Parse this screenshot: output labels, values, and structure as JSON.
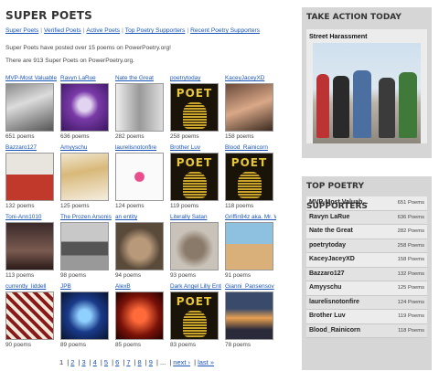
{
  "main": {
    "title": "SUPER POETS",
    "subnav": [
      "Super Poets",
      "Verified Poets",
      "Active Poets",
      "Top Poetry Supporters",
      "Recent Poetry Supporters"
    ],
    "info1": "Super Poets have posted over 15 poems on PowerPoetry.org!",
    "info2": "There are 913 Super Poets on PowerPoetry.org.",
    "poets": [
      {
        "name": "MVP-Most Valuable",
        "count": "651 poems",
        "thumb": "photo-man-cap"
      },
      {
        "name": "Ravyn LaRue",
        "count": "636 poems",
        "thumb": "art-purple"
      },
      {
        "name": "Nate the Great",
        "count": "282 poems",
        "thumb": "photo-bw"
      },
      {
        "name": "poetrytoday",
        "count": "258 poems",
        "thumb": "poet"
      },
      {
        "name": "KaceyJaceyXD",
        "count": "158 poems",
        "thumb": "photo-girls"
      },
      {
        "name": "Bazzaro127",
        "count": "132 poems",
        "thumb": "photo-man-red"
      },
      {
        "name": "Amyyschu",
        "count": "125 poems",
        "thumb": "photo-blonde"
      },
      {
        "name": "laurelisnotonfire",
        "count": "124 poems",
        "thumb": "drawing-hands"
      },
      {
        "name": "Brother Luv",
        "count": "119 poems",
        "thumb": "poet"
      },
      {
        "name": "Blood_Rainicorn",
        "count": "118 poems",
        "thumb": "poet"
      },
      {
        "name": "Toni-Ann1010",
        "count": "113 poems",
        "thumb": "photo-dark"
      },
      {
        "name": "The Prozen Arsonist",
        "count": "98 poems",
        "thumb": "photo-train"
      },
      {
        "name": "an entity",
        "count": "94 poems",
        "thumb": "photo-cat"
      },
      {
        "name": "Literally Satan",
        "count": "93 poems",
        "thumb": "photo-hamster"
      },
      {
        "name": "Griffin94z aka. Mr. Warlow",
        "count": "91 poems",
        "thumb": "photo-beach"
      },
      {
        "name": "currently_liddell",
        "count": "90 poems",
        "thumb": "art-pattern"
      },
      {
        "name": "JPB",
        "count": "89 poems",
        "thumb": "art-blue"
      },
      {
        "name": "AlexB",
        "count": "85 poems",
        "thumb": "photo-red"
      },
      {
        "name": "Dark Angel Lilly Entity",
        "count": "83 poems",
        "thumb": "poet"
      },
      {
        "name": "Gianni_Pansensov",
        "count": "78 poems",
        "thumb": "photo-sunset"
      }
    ],
    "poet_word": "POET",
    "pager": {
      "current": "1",
      "pages": [
        "2",
        "3",
        "4",
        "5",
        "6",
        "7",
        "8",
        "9"
      ],
      "ellipsis": "...",
      "next": "next ›",
      "last": "last »"
    }
  },
  "sidebar": {
    "take_action": {
      "title": "TAKE ACTION TODAY",
      "subtitle": "Street Harassment"
    },
    "supporters": {
      "title": "TOP POETRY SUPPORTERS",
      "items": [
        {
          "name": "MVP-Most Valuab...",
          "count": "651 Poems"
        },
        {
          "name": "Ravyn LaRue",
          "count": "636 Poems"
        },
        {
          "name": "Nate the Great",
          "count": "282 Poems"
        },
        {
          "name": "poetrytoday",
          "count": "258 Poems"
        },
        {
          "name": "KaceyJaceyXD",
          "count": "158 Poems"
        },
        {
          "name": "Bazzaro127",
          "count": "132 Poems"
        },
        {
          "name": "Amyyschu",
          "count": "125 Poems"
        },
        {
          "name": "laurelisnotonfire",
          "count": "124 Poems"
        },
        {
          "name": "Brother Luv",
          "count": "119 Poems"
        },
        {
          "name": "Blood_Rainicorn",
          "count": "118 Poems"
        }
      ]
    }
  },
  "colors": {
    "link": "#1a55b8",
    "sidebar_bg": "#d6d6d6",
    "poet_gold": "#e8c63a"
  }
}
